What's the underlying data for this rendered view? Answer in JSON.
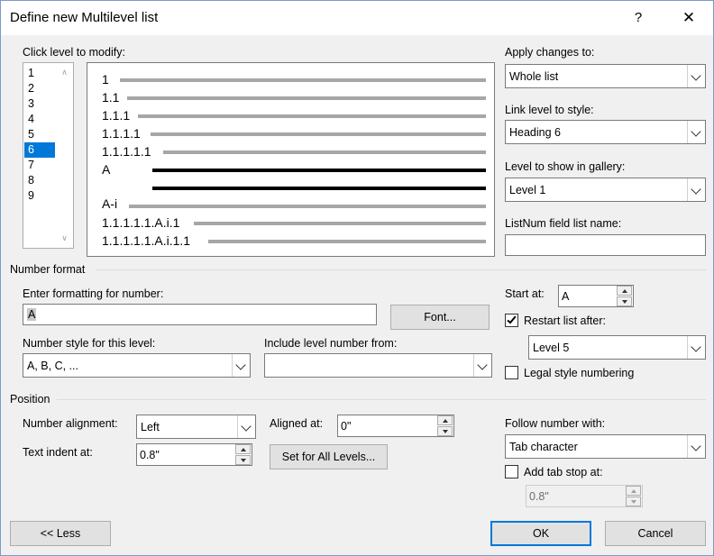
{
  "window": {
    "title": "Define new Multilevel list",
    "help": "?",
    "close": "✕"
  },
  "levels": {
    "label": "Click level to modify:",
    "items": [
      "1",
      "2",
      "3",
      "4",
      "5",
      "6",
      "7",
      "8",
      "9"
    ],
    "selected": "6"
  },
  "preview": {
    "rows": [
      "1",
      "1.1",
      "1.1.1",
      "1.1.1.1",
      "1.1.1.1.1",
      "A",
      "",
      "A-i",
      "1.1.1.1.1.A.i.1",
      "1.1.1.1.1.A.i.1.1"
    ]
  },
  "apply_changes": {
    "label": "Apply changes to:",
    "value": "Whole list"
  },
  "link_level": {
    "label": "Link level to style:",
    "value": "Heading 6"
  },
  "gallery_level": {
    "label": "Level to show in gallery:",
    "value": "Level 1"
  },
  "listnum": {
    "label": "ListNum field list name:",
    "value": ""
  },
  "number_format": {
    "group_label": "Number format",
    "formatting_label": "Enter formatting for number:",
    "formatting_value": "A",
    "font_button": "Font...",
    "style_label": "Number style for this level:",
    "style_value": "A, B, C, ...",
    "include_label": "Include level number from:",
    "include_value": "",
    "start_at_label": "Start at:",
    "start_at_value": "A",
    "restart_label": "Restart list after:",
    "restart_checked": true,
    "restart_value": "Level 5",
    "legal_label": "Legal style numbering",
    "legal_checked": false
  },
  "position": {
    "group_label": "Position",
    "alignment_label": "Number alignment:",
    "alignment_value": "Left",
    "aligned_at_label": "Aligned at:",
    "aligned_at_value": "0\"",
    "indent_label": "Text indent at:",
    "indent_value": "0.8\"",
    "set_all_button": "Set for All Levels...",
    "follow_label": "Follow number with:",
    "follow_value": "Tab character",
    "tab_stop_label": "Add tab stop at:",
    "tab_stop_checked": false,
    "tab_stop_value": "0.8\""
  },
  "footer": {
    "less_button": "<< Less",
    "ok_button": "OK",
    "cancel_button": "Cancel"
  }
}
